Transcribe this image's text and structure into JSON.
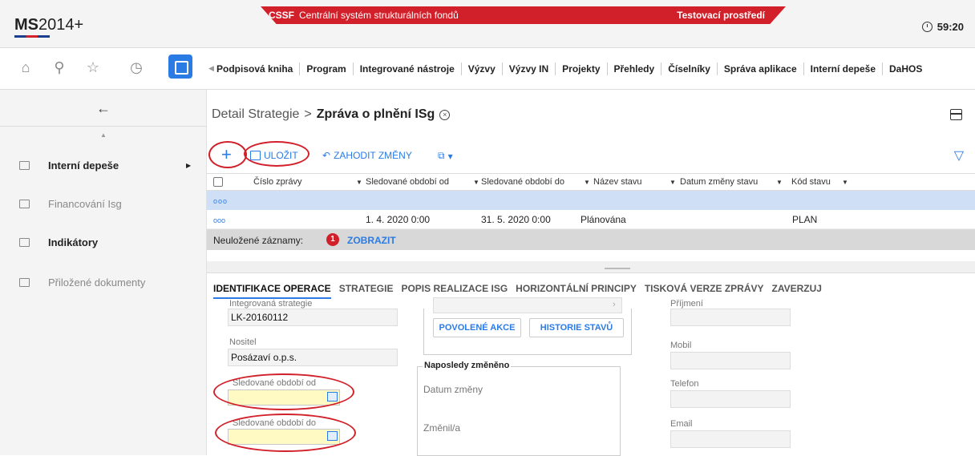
{
  "app": {
    "logo": "MS2014+",
    "logo_plain": "MS",
    "logo_suffix": "2014+"
  },
  "banner": {
    "short": "CSSF",
    "full": "Centrální systém strukturálních fondů",
    "env": "Testovací prostředí"
  },
  "timer": "59:20",
  "nav_icons": [
    "home-icon",
    "search-icon",
    "star-icon",
    "history-icon",
    "windows-icon"
  ],
  "menu": [
    "Podpisová kniha",
    "Program",
    "Integrované nástroje",
    "Výzvy",
    "Výzvy IN",
    "Projekty",
    "Přehledy",
    "Číselníky",
    "Správa aplikace",
    "Interní depeše",
    "DaHOS"
  ],
  "sidebar": {
    "items": [
      {
        "label": "Interní depeše",
        "bold": true
      },
      {
        "label": "Financování Isg",
        "bold": false
      },
      {
        "label": "Indikátory",
        "bold": true
      },
      {
        "label": "Přiložené dokumenty",
        "bold": false
      }
    ]
  },
  "breadcrumb": {
    "parent": "Detail Strategie",
    "sep": ">",
    "current": "Zpráva o plnění ISg"
  },
  "toolbar": {
    "save": "ULOŽIT",
    "discard": "ZAHODIT ZMĚNY"
  },
  "grid": {
    "columns": [
      "Číslo zprávy",
      "Sledované období od",
      "Sledované období do",
      "Název stavu",
      "Datum změny stavu",
      "Kód stavu"
    ],
    "rows": [
      {
        "from": "1. 4. 2020 0:00",
        "to": "31. 5. 2020 0:00",
        "state": "Plánována",
        "code": "PLAN"
      }
    ],
    "ellipsis": "ooo",
    "unsaved_label": "Neuložené záznamy:",
    "unsaved_count": "1",
    "show": "ZOBRAZIT"
  },
  "tabs": [
    "IDENTIFIKACE OPERACE",
    "STRATEGIE",
    "POPIS REALIZACE ISG",
    "HORIZONTÁLNÍ PRINCIPY",
    "TISKOVÁ VERZE ZPRÁVY",
    "ZAVERZUJ"
  ],
  "form": {
    "strategy_label": "Integrovaná strategie",
    "strategy_value": "LK-20160112",
    "holder_label": "Nositel",
    "holder_value": "Posázaví o.p.s.",
    "from_label": "Sledované období od",
    "to_label": "Sledované období do",
    "allowed_actions": "POVOLENÉ AKCE",
    "state_history": "HISTORIE STAVŮ",
    "last_changed": "Naposledy změněno",
    "date_changed": "Datum změny",
    "changed_by": "Změnil/a",
    "surname": "Příjmení",
    "mobile": "Mobil",
    "phone": "Telefon",
    "email": "Email"
  },
  "colors": {
    "accent": "#2b7be4",
    "brand_red": "#d2202a",
    "selected_row": "#cfe0f6",
    "required_field": "#fff9c4"
  }
}
